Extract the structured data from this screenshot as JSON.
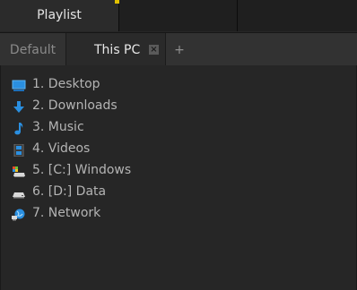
{
  "top_tabs": {
    "playlist_label": "Playlist"
  },
  "sub_tabs": {
    "default_label": "Default",
    "this_pc_label": "This PC",
    "close_glyph": "×",
    "add_glyph": "+"
  },
  "locations": [
    {
      "label": "1. Desktop",
      "icon": "desktop-icon"
    },
    {
      "label": "2. Downloads",
      "icon": "download-arrow-icon"
    },
    {
      "label": "3. Music",
      "icon": "music-note-icon"
    },
    {
      "label": "4. Videos",
      "icon": "film-icon"
    },
    {
      "label": "5. [C:] Windows",
      "icon": "system-drive-icon"
    },
    {
      "label": "6. [D:] Data",
      "icon": "drive-icon"
    },
    {
      "label": "7. Network",
      "icon": "network-icon"
    }
  ],
  "colors": {
    "accent": "#e0c000",
    "icon_blue": "#2a8fe0"
  }
}
